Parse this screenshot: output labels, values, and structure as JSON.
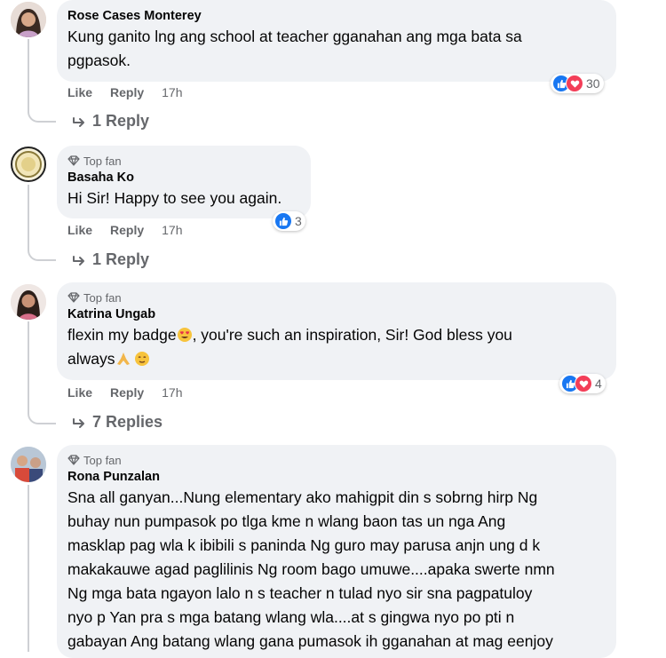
{
  "comments": [
    {
      "author": "Rose Cases Monterey",
      "text_line1": "Kung ganito lng ang school at teacher gganahan ang mga bata sa",
      "text_line2": "pgpasok.",
      "like_label": "Like",
      "reply_label": "Reply",
      "time": "17h",
      "reaction_count": "30",
      "reactions": [
        "like-icon",
        "love-icon"
      ],
      "replies_label": "1 Reply"
    },
    {
      "badge": "Top fan",
      "author": "Basaha Ko",
      "text_line1": "Hi Sir! Happy to see you again.",
      "like_label": "Like",
      "reply_label": "Reply",
      "time": "17h",
      "reaction_count": "3",
      "reactions": [
        "like-icon"
      ],
      "replies_label": "1 Reply"
    },
    {
      "badge": "Top fan",
      "author": "Katrina Ungab",
      "text_line1a": "flexin my badge",
      "text_line1b": ", you're such an inspiration, Sir! God bless you",
      "text_line2": "always",
      "like_label": "Like",
      "reply_label": "Reply",
      "time": "17h",
      "reaction_count": "4",
      "reactions": [
        "like-icon",
        "love-icon"
      ],
      "replies_label": "7 Replies"
    },
    {
      "badge": "Top fan",
      "author": "Rona Punzalan",
      "lines": [
        "Sna all ganyan...Nung elementary ako mahigpit din s sobrng hirp Ng",
        "buhay nun pumpasok po tlga kme n wlang baon tas un nga Ang",
        "masklap pag wla k ibibili s paninda Ng guro may parusa anjn ung d k",
        "makakauwe agad paglilinis Ng room bago umuwe....apaka swerte nmn",
        "Ng mga bata ngayon lalo n s teacher n tulad nyo sir sna pagpatuloy",
        "nyo p Yan pra s mga batang wlang wla....at s gingwa nyo po pti n",
        "gabayan Ang batang wlang gana pumasok ih gganahan at mag eenjoy"
      ]
    }
  ],
  "colors": {
    "like": "#1877f2",
    "love": "#f33e58",
    "bubble": "#f0f2f5",
    "secondary_text": "#65676b"
  }
}
